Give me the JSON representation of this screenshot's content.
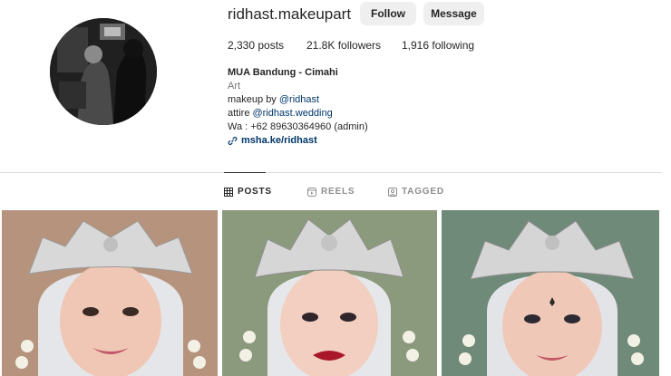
{
  "profile": {
    "username": "ridhast.makeupart",
    "follow_label": "Follow",
    "message_label": "Message",
    "stats": {
      "posts": "2,330 posts",
      "followers": "21.8K followers",
      "following": "1,916 following"
    },
    "bio": {
      "name": "MUA Bandung - Cimahi",
      "category": "Art",
      "line1_prefix": "makeup by ",
      "line1_link": "@ridhast",
      "line2_prefix": "attire ",
      "line2_link": "@ridhast.wedding",
      "line3": "Wa : +62 89630364960 (admin)",
      "website": "msha.ke/ridhast"
    }
  },
  "tabs": [
    {
      "label": "POSTS",
      "icon": "grid-icon",
      "active": true
    },
    {
      "label": "REELS",
      "icon": "reels-icon",
      "active": false
    },
    {
      "label": "TAGGED",
      "icon": "tagged-icon",
      "active": false
    }
  ],
  "posts": [
    {
      "icon": "photo-bride-1"
    },
    {
      "icon": "photo-bride-2"
    },
    {
      "icon": "photo-bride-3"
    }
  ],
  "colors": {
    "button_bg": "#efefef",
    "link": "#00376b",
    "muted": "#737373",
    "divider": "#dbdbdb"
  }
}
